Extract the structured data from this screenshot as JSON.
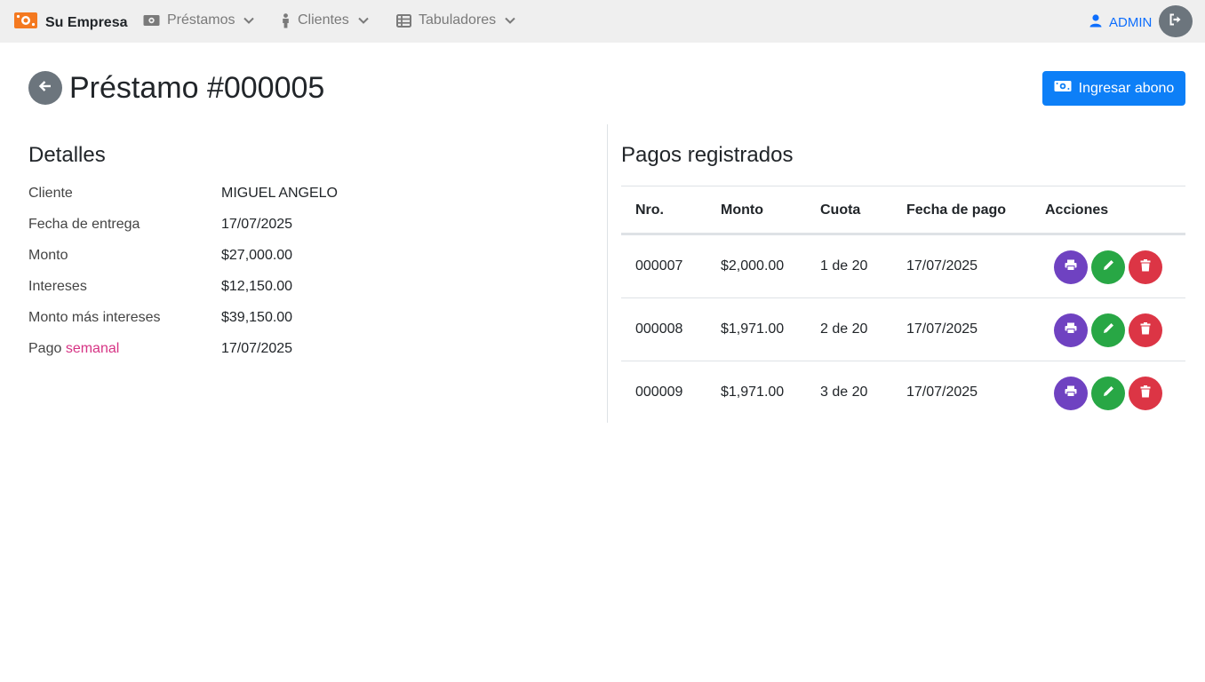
{
  "colors": {
    "primary": "#0d7ff7",
    "nav_bg": "#efefef",
    "brand_icon": "#f47920",
    "print": "#6f42c1",
    "edit": "#28a745",
    "delete": "#dc3545",
    "secondary": "#6c757d",
    "accent": "#d63384"
  },
  "navbar": {
    "brand": "Su Empresa",
    "brand_icon": "money-bill-icon",
    "menus": [
      {
        "label": "Préstamos",
        "icon": "money-bill-icon"
      },
      {
        "label": "Clientes",
        "icon": "person-icon"
      },
      {
        "label": "Tabuladores",
        "icon": "table-icon"
      }
    ],
    "user": "ADMIN",
    "logout_icon": "sign-out-icon"
  },
  "header": {
    "title": "Préstamo #000005",
    "back_icon": "arrow-left-icon",
    "action_label": "Ingresar abono",
    "action_icon": "money-bill-icon"
  },
  "details": {
    "title": "Detalles",
    "rows": [
      {
        "label": "Cliente",
        "value": "MIGUEL ANGELO"
      },
      {
        "label": "Fecha de entrega",
        "value": "17/07/2025"
      },
      {
        "label": "Monto",
        "value": "$27,000.00"
      },
      {
        "label": "Intereses",
        "value": "$12,150.00"
      },
      {
        "label": "Monto más intereses",
        "value": "$39,150.00"
      }
    ],
    "payment_row": {
      "label_prefix": "Pago",
      "label_highlight": "semanal",
      "value": "17/07/2025"
    }
  },
  "payments": {
    "title": "Pagos registrados",
    "columns": [
      "Nro.",
      "Monto",
      "Cuota",
      "Fecha de pago",
      "Acciones"
    ],
    "rows": [
      {
        "nro": "000007",
        "monto": "$2,000.00",
        "cuota": "1 de 20",
        "fecha": "17/07/2025"
      },
      {
        "nro": "000008",
        "monto": "$1,971.00",
        "cuota": "2 de 20",
        "fecha": "17/07/2025"
      },
      {
        "nro": "000009",
        "monto": "$1,971.00",
        "cuota": "3 de 20",
        "fecha": "17/07/2025"
      }
    ],
    "action_icons": [
      "print-icon",
      "pencil-icon",
      "trash-icon"
    ]
  }
}
